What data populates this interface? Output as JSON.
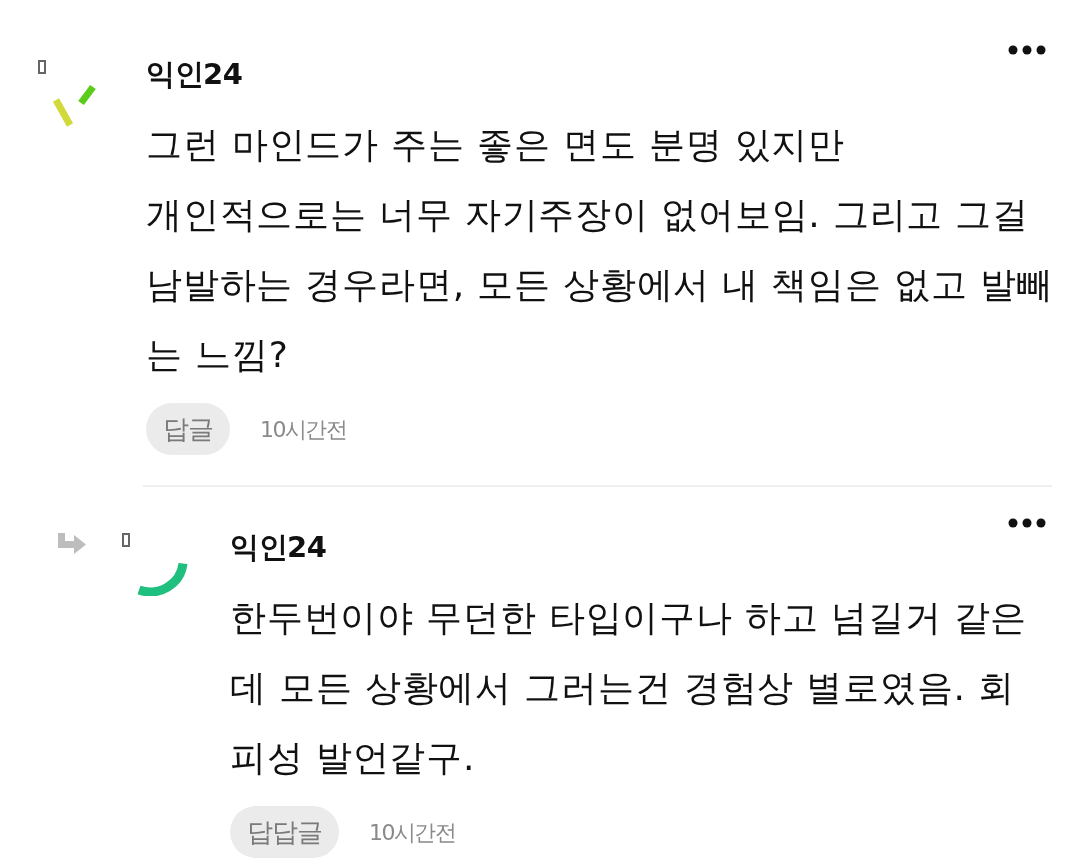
{
  "comments": [
    {
      "is_reply": false,
      "avatar": {
        "kind": "strokes"
      },
      "author": "익인24",
      "lines": [
        "그런 마인드가 주는 좋은 면도 분명 있지만",
        "개인적으로는 너무 자기주장이 없어보임. 그리고 그걸",
        "남발하는 경우라면, 모든 상황에서 내 책임은 없고 발빼",
        "는 느낌?"
      ],
      "reply_button": "답글",
      "time": "10시간전"
    },
    {
      "is_reply": true,
      "avatar": {
        "kind": "arc"
      },
      "author": "익인24",
      "lines": [
        "한두번이야 무던한 타입이구나 하고 넘길거 같은",
        "데 모든 상황에서 그러는건 경험상 별로였음. 회",
        "피성 발언같구."
      ],
      "reply_button": "답답글",
      "time": "10시간전"
    }
  ]
}
